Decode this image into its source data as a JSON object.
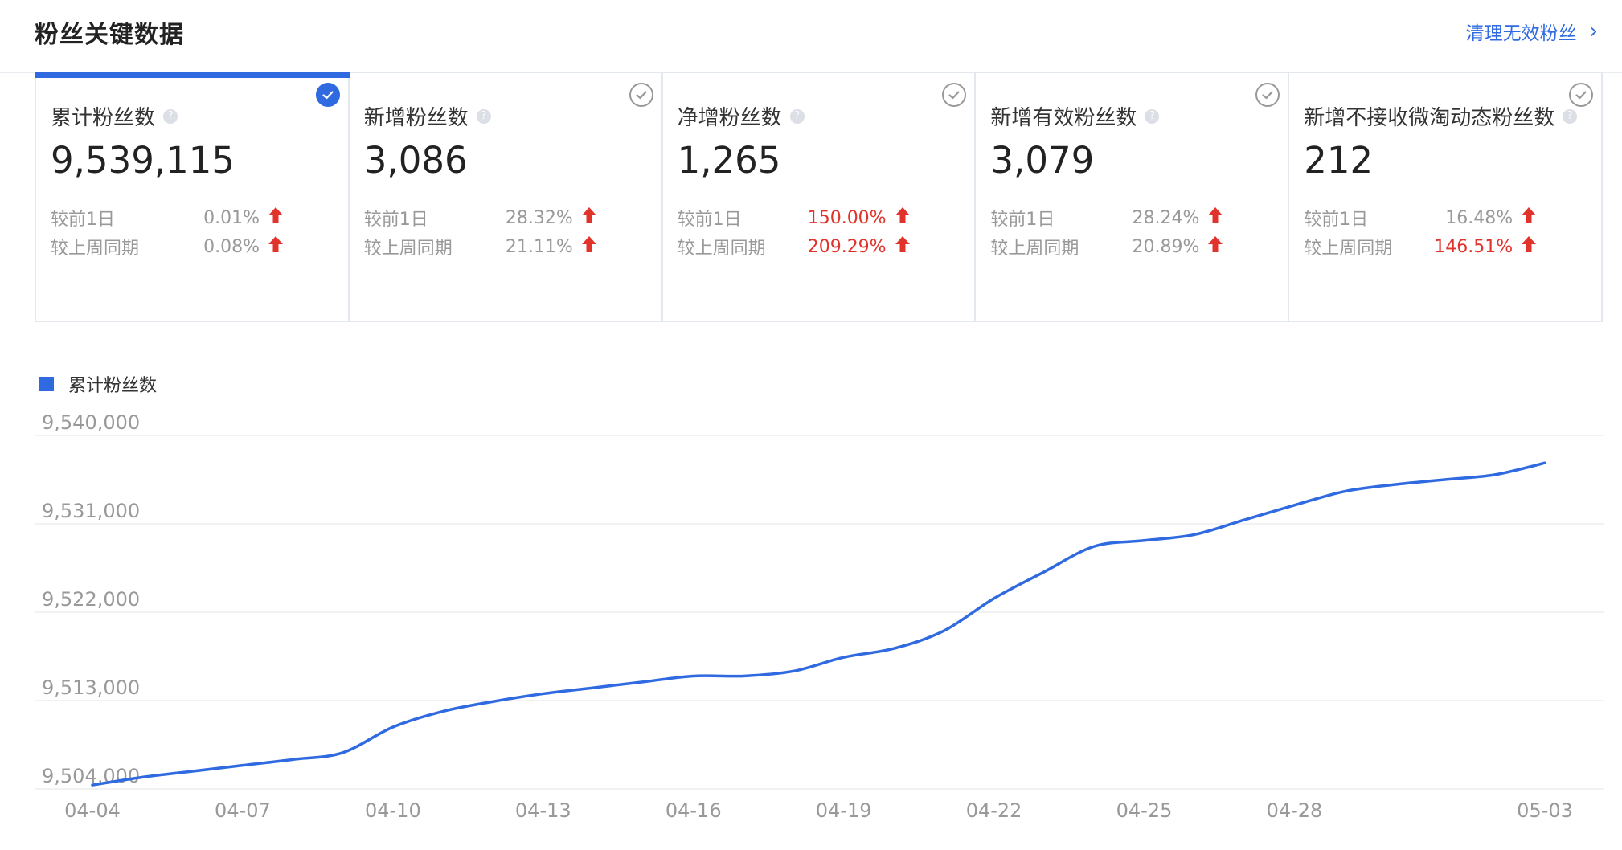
{
  "header": {
    "title": "粉丝关键数据",
    "clean_link": "清理无效粉丝",
    "chevron_glyph": "›"
  },
  "cards": [
    {
      "label": "累计粉丝数",
      "value": "9,539,115",
      "selected": true,
      "compare": [
        {
          "label": "较前1日",
          "value": "0.01%",
          "red": false
        },
        {
          "label": "较上周同期",
          "value": "0.08%",
          "red": false
        }
      ]
    },
    {
      "label": "新增粉丝数",
      "value": "3,086",
      "selected": false,
      "compare": [
        {
          "label": "较前1日",
          "value": "28.32%",
          "red": false
        },
        {
          "label": "较上周同期",
          "value": "21.11%",
          "red": false
        }
      ]
    },
    {
      "label": "净增粉丝数",
      "value": "1,265",
      "selected": false,
      "compare": [
        {
          "label": "较前1日",
          "value": "150.00%",
          "red": true
        },
        {
          "label": "较上周同期",
          "value": "209.29%",
          "red": true
        }
      ]
    },
    {
      "label": "新增有效粉丝数",
      "value": "3,079",
      "selected": false,
      "compare": [
        {
          "label": "较前1日",
          "value": "28.24%",
          "red": false
        },
        {
          "label": "较上周同期",
          "value": "20.89%",
          "red": false
        }
      ]
    },
    {
      "label": "新增不接收微淘动态粉丝数",
      "value": "212",
      "selected": false,
      "compare": [
        {
          "label": "较前1日",
          "value": "16.48%",
          "red": false
        },
        {
          "label": "较上周同期",
          "value": "146.51%",
          "red": true
        }
      ]
    }
  ],
  "colors": {
    "accent": "#2f6ae0",
    "up_arrow": "#e0332c",
    "red_text": "#e0332c",
    "muted": "#999999"
  },
  "icons": {
    "help": "question-circle-icon",
    "up": "arrow-up-icon",
    "check": "check-circle-icon"
  },
  "chart_data": {
    "type": "line",
    "legend": "top-left",
    "grid": true,
    "series": [
      {
        "name": "累计粉丝数",
        "x": [
          "04-04",
          "04-05",
          "04-06",
          "04-07",
          "04-08",
          "04-09",
          "04-10",
          "04-11",
          "04-12",
          "04-13",
          "04-14",
          "04-15",
          "04-16",
          "04-17",
          "04-18",
          "04-19",
          "04-20",
          "04-21",
          "04-22",
          "04-23",
          "04-24",
          "04-25",
          "04-26",
          "04-27",
          "04-28",
          "04-29",
          "04-30",
          "05-01",
          "05-02",
          "05-03"
        ],
        "values": [
          9504400,
          9505200,
          9505800,
          9506400,
          9507000,
          9507700,
          9510300,
          9511900,
          9512900,
          9513700,
          9514300,
          9514900,
          9515500,
          9515500,
          9516000,
          9517400,
          9518300,
          9520100,
          9523400,
          9526100,
          9528700,
          9529300,
          9529900,
          9531400,
          9532900,
          9534300,
          9535000,
          9535500,
          9536000,
          9537200
        ]
      }
    ],
    "x_tick_labels": [
      "04-04",
      "04-07",
      "04-10",
      "04-13",
      "04-16",
      "04-19",
      "04-22",
      "04-25",
      "04-28",
      "05-03"
    ],
    "y_ticks": [
      9504000,
      9513000,
      9522000,
      9531000,
      9540000
    ],
    "y_tick_labels": [
      "9,504,000",
      "9,513,000",
      "9,522,000",
      "9,531,000",
      "9,540,000"
    ],
    "ylim": [
      9504000,
      9540000
    ]
  }
}
